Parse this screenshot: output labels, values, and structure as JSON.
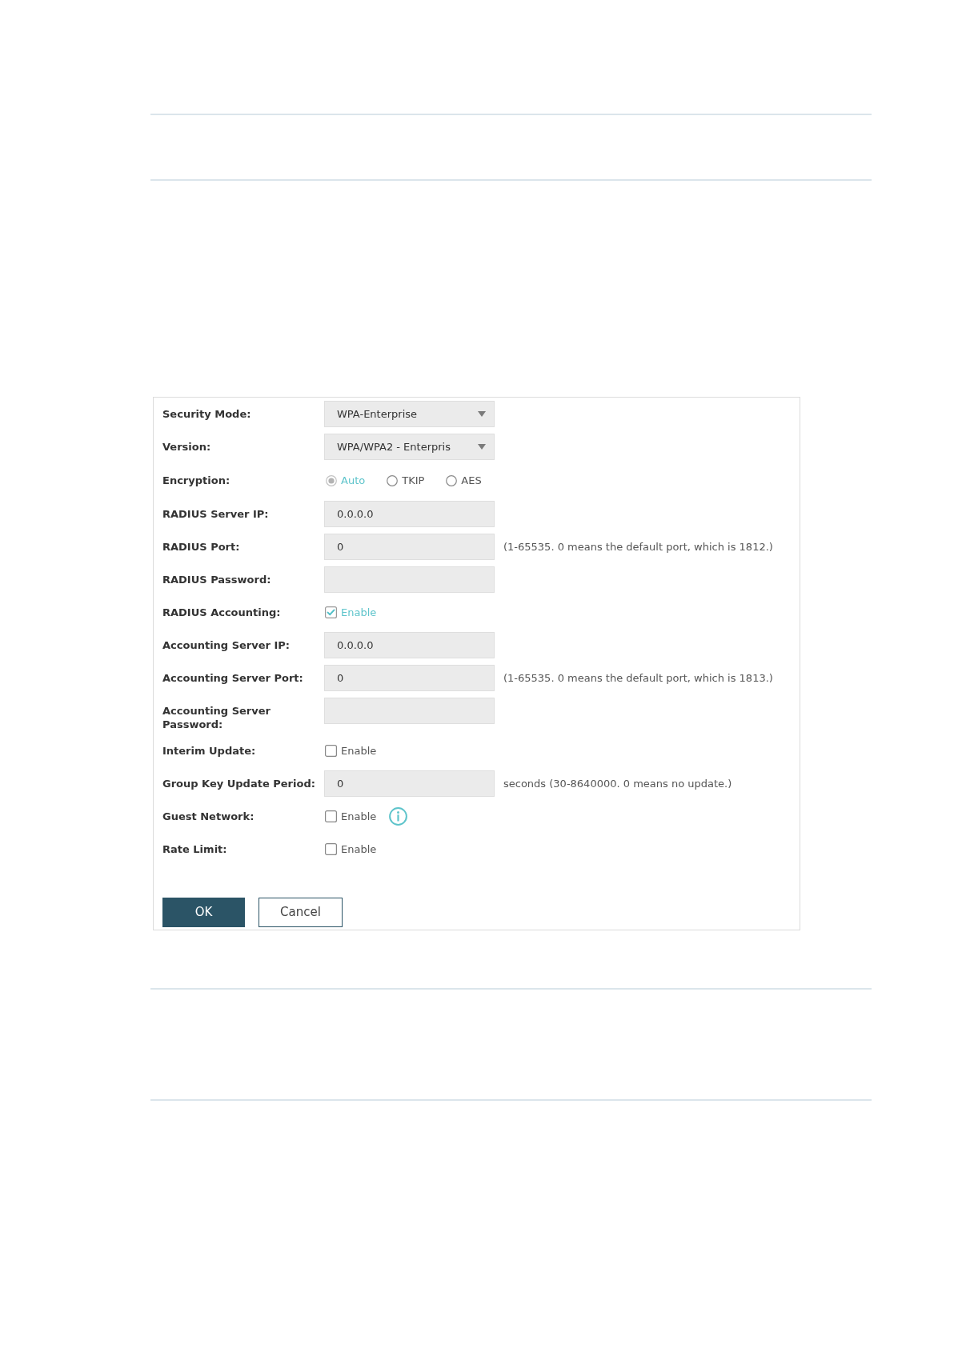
{
  "form": {
    "fields": [
      {
        "kind": "select",
        "label": "Security Mode:",
        "value": "WPA-Enterprise"
      },
      {
        "kind": "select",
        "label": "Version:",
        "value": "WPA/WPA2 - Enterpris"
      },
      {
        "kind": "radio",
        "label": "Encryption:",
        "options": [
          {
            "label": "Auto",
            "selected": true
          },
          {
            "label": "TKIP",
            "selected": false
          },
          {
            "label": "AES",
            "selected": false
          }
        ]
      },
      {
        "kind": "text",
        "label": "RADIUS Server IP:",
        "value": "0.0.0.0"
      },
      {
        "kind": "text",
        "label": "RADIUS Port:",
        "value": "0",
        "hint": "(1-65535. 0 means the default port, which is 1812.)"
      },
      {
        "kind": "password",
        "label": "RADIUS Password:"
      },
      {
        "kind": "checkbox",
        "label": "RADIUS Accounting:",
        "option": "Enable",
        "checked": true,
        "info": false
      },
      {
        "kind": "text",
        "label": "Accounting Server IP:",
        "value": "0.0.0.0"
      },
      {
        "kind": "text",
        "label": "Accounting Server Port:",
        "value": "0",
        "hint": "(1-65535. 0 means the default port, which is 1813.)"
      },
      {
        "kind": "password",
        "label": "Accounting Server Password:"
      },
      {
        "kind": "checkbox",
        "label": "Interim Update:",
        "option": "Enable",
        "checked": false,
        "info": false
      },
      {
        "kind": "text",
        "label": "Group Key Update Period:",
        "value": "0",
        "hint": "seconds (30-8640000. 0 means no update.)"
      },
      {
        "kind": "checkbox",
        "label": "Guest Network:",
        "option": "Enable",
        "checked": false,
        "info": true
      },
      {
        "kind": "checkbox",
        "label": "Rate Limit:",
        "option": "Enable",
        "checked": false,
        "info": false
      }
    ],
    "buttons": [
      {
        "kind": "primary",
        "label": "OK"
      },
      {
        "kind": "secondary",
        "label": "Cancel"
      }
    ]
  }
}
